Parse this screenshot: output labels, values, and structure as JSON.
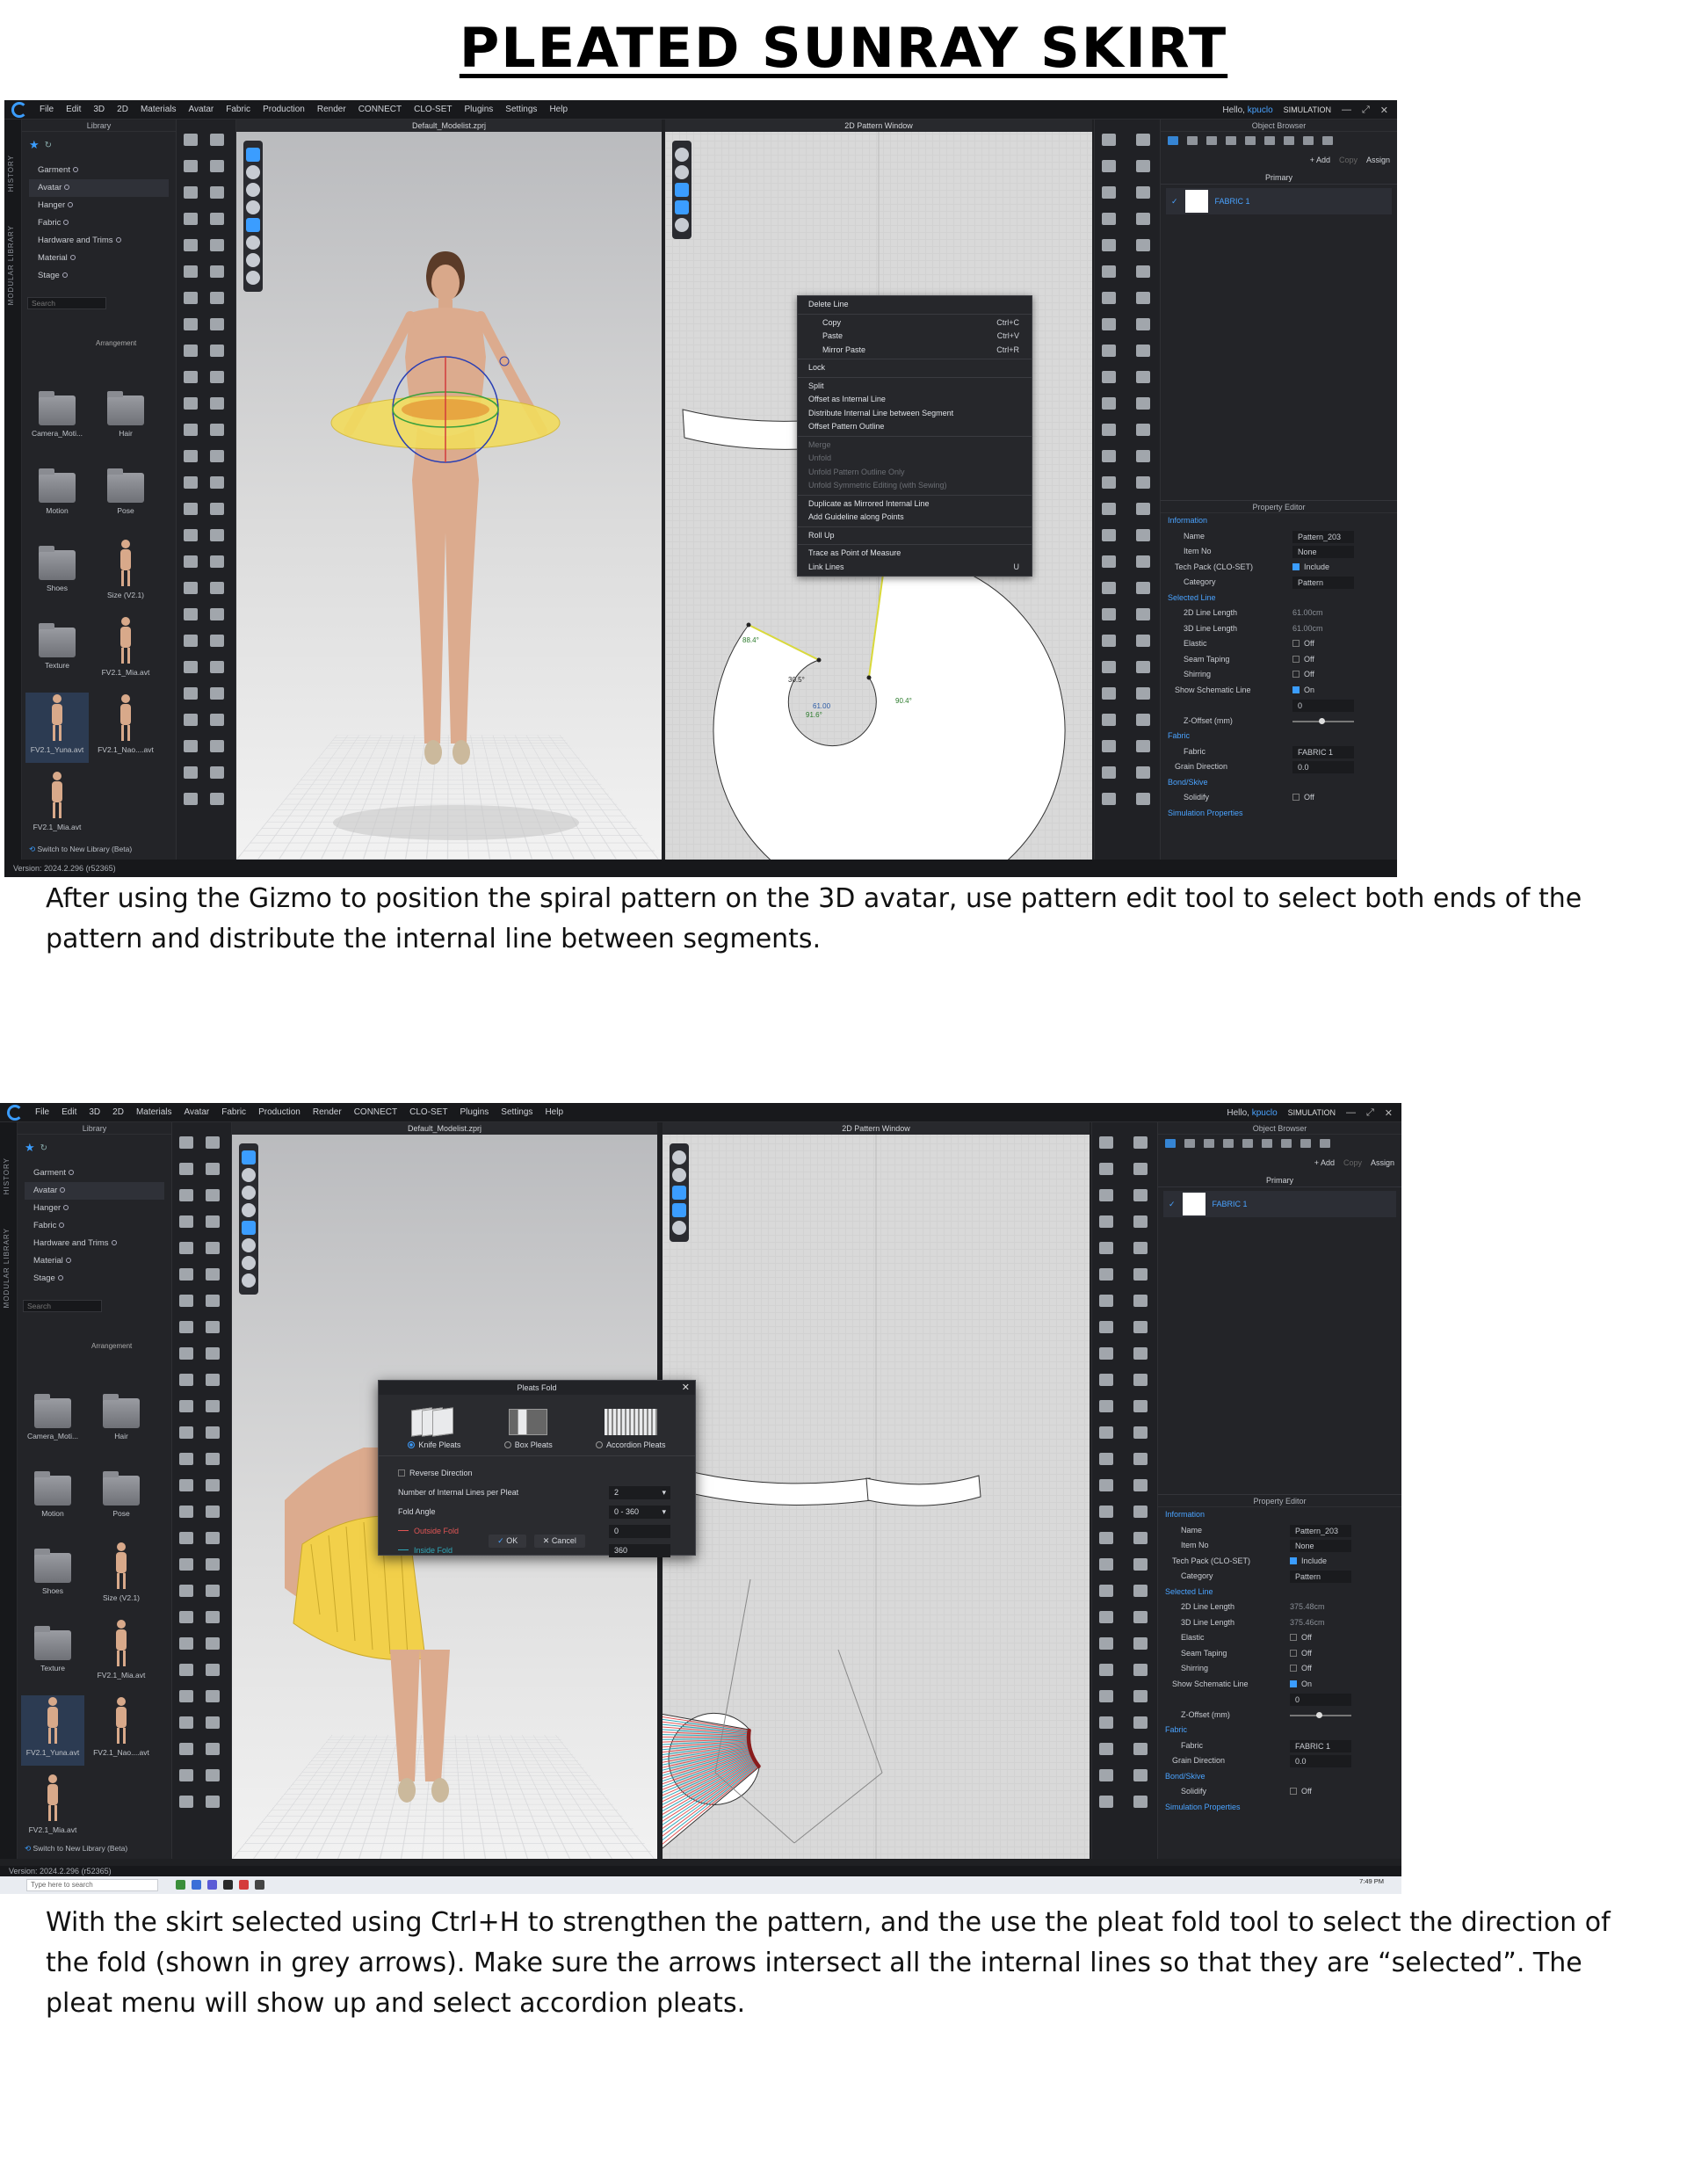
{
  "page_title": "PLEATED SUNRAY SKIRT",
  "captions": [
    "After using the Gizmo to position the spiral pattern on the 3D avatar, use pattern edit tool to select both ends of the pattern and distribute the internal line between segments.",
    "With the skirt selected using Ctrl+H to strengthen the pattern, and the use the pleat fold tool to select the direction of the fold (shown in grey arrows). Make sure the arrows intersect all the internal lines so that they are “selected”. The pleat menu will show up and select accordion pleats."
  ],
  "menu": [
    "File",
    "Edit",
    "3D",
    "2D",
    "Materials",
    "Avatar",
    "Fabric",
    "Production",
    "Render",
    "CONNECT",
    "CLO-SET",
    "Plugins",
    "Settings",
    "Help"
  ],
  "hello_prefix": "Hello,",
  "user": "kpuclo",
  "sim_badge": "SIMULATION",
  "side_tabs": [
    "HISTORY",
    "MODULAR LIBRARY"
  ],
  "library": {
    "title": "Library",
    "tree": [
      "Garment",
      "Avatar",
      "Hanger",
      "Fabric",
      "Hardware and Trims",
      "Material",
      "Stage"
    ],
    "search_placeholder": "Search",
    "sort_label": "Arrangement",
    "items": [
      "Camera_Moti...",
      "Hair",
      "Motion",
      "Pose",
      "Shoes",
      "Size (V2.1)",
      "Texture",
      "FV2.1_Mia.avt",
      "FV2.1_Yuna.avt",
      "FV2.1_Nao....avt",
      "FV2.1_Mia.avt"
    ],
    "footer": "Switch to New Library (Beta)"
  },
  "viewport_title": "Default_Modelist.zprj",
  "pattern_window_title": "2D Pattern Window",
  "object_browser": {
    "title": "Object Browser",
    "add": "+ Add",
    "copy": "Copy",
    "assign": "Assign",
    "primary": "Primary",
    "fabric_name": "FABRIC 1"
  },
  "context_menu": {
    "items": [
      {
        "label": "Delete Line",
        "shortcut": "",
        "disabled": false
      },
      {
        "label": "Copy",
        "shortcut": "Ctrl+C",
        "disabled": false,
        "sub": true
      },
      {
        "label": "Paste",
        "shortcut": "Ctrl+V",
        "disabled": false,
        "sub": true
      },
      {
        "label": "Mirror Paste",
        "shortcut": "Ctrl+R",
        "disabled": false,
        "sub": true
      },
      {
        "label": "Lock",
        "shortcut": "",
        "disabled": false
      },
      {
        "label": "Split",
        "shortcut": "",
        "disabled": false
      },
      {
        "label": "Offset as Internal Line",
        "shortcut": "",
        "disabled": false
      },
      {
        "label": "Distribute Internal Line between Segment",
        "shortcut": "",
        "disabled": false
      },
      {
        "label": "Offset Pattern Outline",
        "shortcut": "",
        "disabled": false
      },
      {
        "label": "Merge",
        "shortcut": "",
        "disabled": true
      },
      {
        "label": "Unfold",
        "shortcut": "",
        "disabled": true
      },
      {
        "label": "Unfold Pattern Outline Only",
        "shortcut": "",
        "disabled": true
      },
      {
        "label": "Unfold Symmetric Editing (with Sewing)",
        "shortcut": "",
        "disabled": true
      },
      {
        "label": "Duplicate as Mirrored Internal Line",
        "shortcut": "",
        "disabled": false
      },
      {
        "label": "Add Guideline along Points",
        "shortcut": "",
        "disabled": false
      },
      {
        "label": "Roll Up",
        "shortcut": "",
        "disabled": false
      },
      {
        "label": "Trace as Point of Measure",
        "shortcut": "",
        "disabled": false
      },
      {
        "label": "Link Lines",
        "shortcut": "U",
        "disabled": false
      }
    ]
  },
  "pattern_labels": [
    "88.4°",
    "30.5°",
    "61.00",
    "91.6°",
    "90.4°"
  ],
  "property_editor": {
    "title": "Property Editor",
    "screen1": [
      {
        "k": "Information",
        "sec": true
      },
      {
        "k": "Name",
        "v": "Pattern_203",
        "box": true
      },
      {
        "k": "Item No",
        "v": "None",
        "box": true
      },
      {
        "k": "Tech Pack (CLO-SET)",
        "v": "Include",
        "cb": true,
        "sub": true
      },
      {
        "k": "Category",
        "v": "Pattern",
        "box": true
      },
      {
        "k": "Selected Line",
        "sec": true
      },
      {
        "k": "2D Line Length",
        "v": "61.00cm",
        "muted": true
      },
      {
        "k": "3D Line Length",
        "v": "61.00cm",
        "muted": true
      },
      {
        "k": "Elastic",
        "v": "Off",
        "cbo": true
      },
      {
        "k": "Seam Taping",
        "v": "Off",
        "cbo": true
      },
      {
        "k": "Shirring",
        "v": "Off",
        "cbo": true
      },
      {
        "k": "Show Schematic Line",
        "v": "On",
        "cb": true,
        "sub": true
      },
      {
        "k": "",
        "v": "0",
        "box": true
      },
      {
        "k": "Z-Offset (mm)",
        "slider": true
      },
      {
        "k": "Fabric",
        "sec": true
      },
      {
        "k": "Fabric",
        "v": "FABRIC 1",
        "box": true
      },
      {
        "k": "Grain Direction",
        "v": "0.0",
        "box": true,
        "sub": true
      },
      {
        "k": "Bond/Skive",
        "sec": true
      },
      {
        "k": "Solidify",
        "v": "Off",
        "cbo": true,
        "secrow": true
      },
      {
        "k": "Simulation Properties",
        "sec": true
      }
    ],
    "screen2": [
      {
        "k": "Information",
        "sec": true
      },
      {
        "k": "Name",
        "v": "Pattern_203",
        "box": true
      },
      {
        "k": "Item No",
        "v": "None",
        "box": true
      },
      {
        "k": "Tech Pack (CLO-SET)",
        "v": "Include",
        "cb": true,
        "sub": true
      },
      {
        "k": "Category",
        "v": "Pattern",
        "box": true
      },
      {
        "k": "Selected Line",
        "sec": true
      },
      {
        "k": "2D Line Length",
        "v": "375.48cm",
        "muted": true
      },
      {
        "k": "3D Line Length",
        "v": "375.46cm",
        "muted": true
      },
      {
        "k": "Elastic",
        "v": "Off",
        "cbo": true
      },
      {
        "k": "Seam Taping",
        "v": "Off",
        "cbo": true
      },
      {
        "k": "Shirring",
        "v": "Off",
        "cbo": true
      },
      {
        "k": "Show Schematic Line",
        "v": "On",
        "cb": true,
        "sub": true
      },
      {
        "k": "",
        "v": "0",
        "box": true
      },
      {
        "k": "Z-Offset (mm)",
        "slider": true
      },
      {
        "k": "Fabric",
        "sec": true
      },
      {
        "k": "Fabric",
        "v": "FABRIC 1",
        "box": true
      },
      {
        "k": "Grain Direction",
        "v": "0.0",
        "box": true,
        "sub": true
      },
      {
        "k": "Bond/Skive",
        "sec": true
      },
      {
        "k": "Solidify",
        "v": "Off",
        "cbo": true,
        "secrow": true
      },
      {
        "k": "Simulation Properties",
        "sec": true
      }
    ]
  },
  "pleats_dialog": {
    "title": "Pleats Fold",
    "options": [
      "Knife Pleats",
      "Box Pleats",
      "Accordion Pleats"
    ],
    "reverse_direction": "Reverse Direction",
    "num_lines_label": "Number of Internal Lines per Pleat",
    "num_lines_value": "2",
    "fold_angle_label": "Fold Angle",
    "fold_angle_value": "0 - 360",
    "outside_fold_label": "Outside Fold",
    "outside_fold_value": "0",
    "inside_fold_label": "Inside Fold",
    "inside_fold_value": "360",
    "ok": "OK",
    "cancel": "Cancel"
  },
  "version": "Version: 2024.2.296 (r52365)",
  "taskbar": {
    "search": "Type here to search",
    "time": "7:49 PM"
  },
  "colors": {
    "accent": "#3b9dff",
    "outside_fold": "#e05555",
    "inside_fold": "#2fa7b9",
    "yellow_skirt": "#f2dc5d"
  }
}
